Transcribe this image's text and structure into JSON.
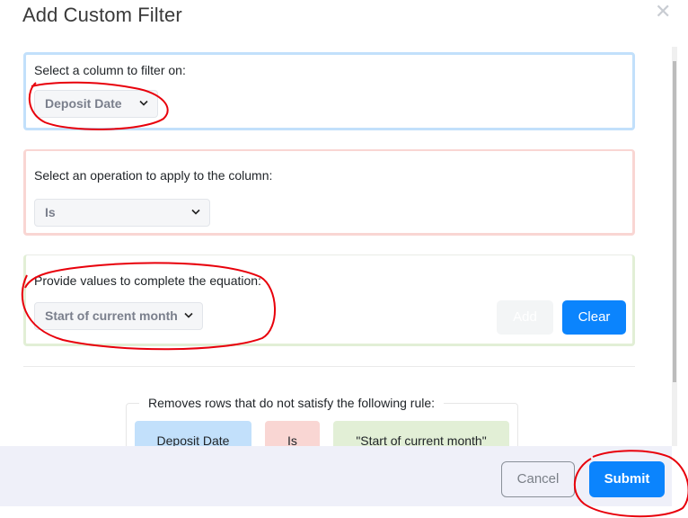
{
  "dialog": {
    "title": "Add Custom Filter",
    "close_icon": "close-icon"
  },
  "column_section": {
    "label": "Select a column to filter on:",
    "selected": "Deposit Date",
    "accent": "#c2e0fb"
  },
  "operation_section": {
    "label": "Select an operation to apply to the column:",
    "selected": "Is",
    "accent": "#f9d6d3"
  },
  "value_section": {
    "label": "Provide values to complete the equation:",
    "selected": "Start of current month",
    "add_label": "Add",
    "clear_label": "Clear",
    "accent": "#e2efd6"
  },
  "rule_summary": {
    "legend": "Removes rows that do not satisfy the following rule:",
    "column": "Deposit Date",
    "operation": "Is",
    "value": "\"Start of current month\""
  },
  "footer": {
    "cancel_label": "Cancel",
    "submit_label": "Submit",
    "primary_color": "#0b84fd"
  },
  "annotations": {
    "color": "#e8000b",
    "circled": [
      "column-select",
      "value-section",
      "submit-button"
    ]
  }
}
